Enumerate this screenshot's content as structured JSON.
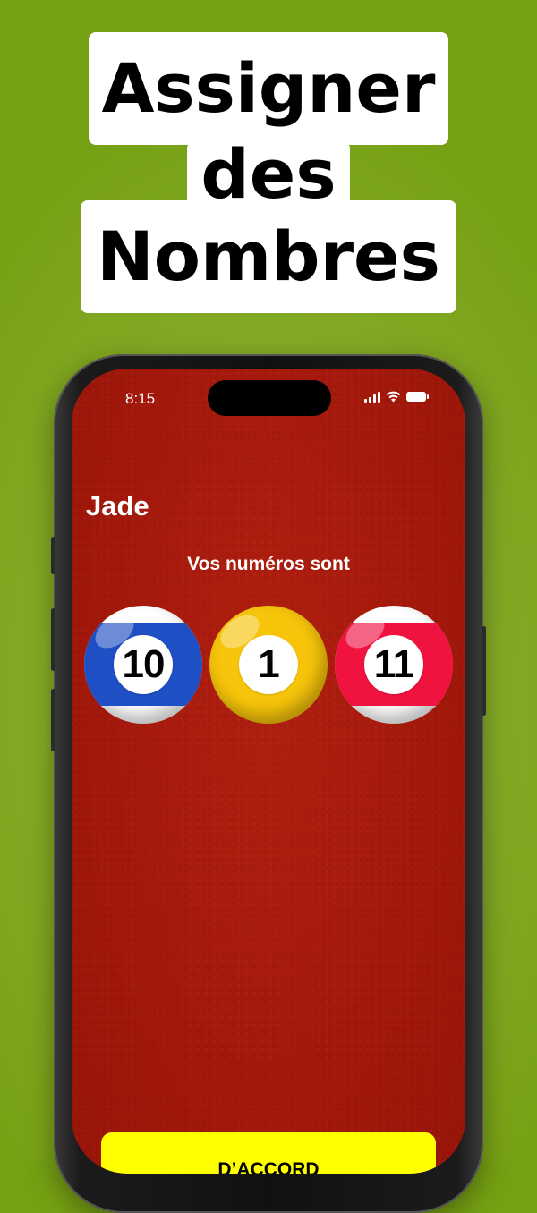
{
  "headline": {
    "line1": "Assigner",
    "line2": "des",
    "line3": "Nombres"
  },
  "status_bar": {
    "time": "8:15",
    "icons": [
      "signal-icon",
      "wifi-icon",
      "battery-icon"
    ]
  },
  "screen": {
    "player_name": "Jade",
    "numbers_label": "Vos numéros sont",
    "balls": [
      {
        "number": "10",
        "style": "stripe",
        "color": "#1f4fc4"
      },
      {
        "number": "1",
        "style": "solid",
        "color": "#f6c40a"
      },
      {
        "number": "11",
        "style": "stripe",
        "color": "#f0123f"
      }
    ],
    "ok_button_label": "D’ACCORD"
  },
  "colors": {
    "background": "#75a013",
    "felt": "#a81a0c",
    "button": "#ffff00"
  }
}
